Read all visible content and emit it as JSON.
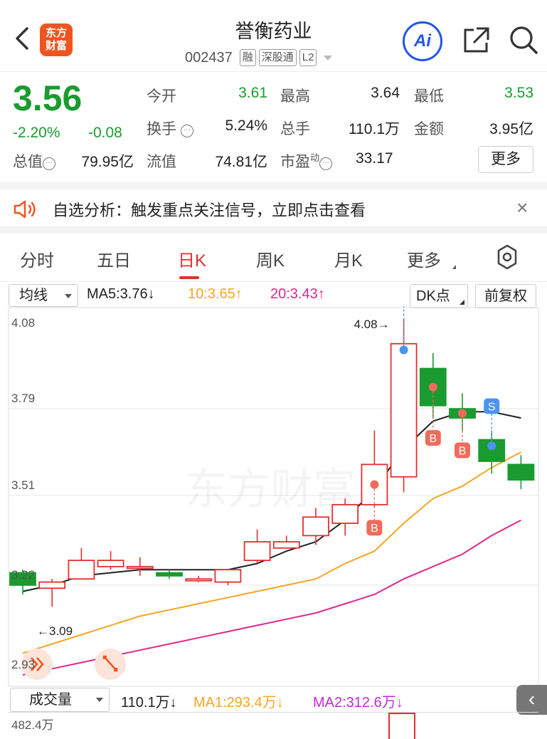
{
  "header": {
    "title": "誉衡药业",
    "code": "002437",
    "tags": [
      "融",
      "深股通",
      "L2"
    ],
    "logo_text": [
      "东方",
      "财富"
    ],
    "ai_label": "Ai",
    "icons": [
      "back-chevron-icon",
      "share-icon",
      "search-icon"
    ]
  },
  "quote": {
    "price": "3.56",
    "change_pct": "-2.20%",
    "change": "-0.08",
    "open_label": "今开",
    "open": "3.61",
    "high_label": "最高",
    "high": "3.64",
    "low_label": "最低",
    "low": "3.53",
    "turnover_label": "换手",
    "turnover": "5.24%",
    "volume_label": "总手",
    "volume": "110.1万",
    "amount_label": "金额",
    "amount": "3.95亿",
    "mktcap_label": "总值",
    "mktcap": "79.95亿",
    "float_label": "流值",
    "float_cap": "74.81亿",
    "pe_label": "市盈",
    "pe_sup": "动",
    "pe": "33.17",
    "more_label": "更多",
    "colors": {
      "down": "#1a9b2f",
      "up": "#e03030"
    }
  },
  "notice": {
    "text": "自选分析：触发重点关注信号，立即点击查看",
    "icon": "speaker-icon",
    "close": "×"
  },
  "tabs": {
    "items": [
      "分时",
      "五日",
      "日K",
      "周K",
      "月K",
      "更多"
    ],
    "active": "日K",
    "settings_icon": "gear-icon"
  },
  "indicators": {
    "main_select": "均线",
    "ma5": "MA5:3.76↓",
    "ma10": "10:3.65↑",
    "ma20": "20:3.43↑",
    "dk": "DK点",
    "adjust": "前复权",
    "colors": {
      "ma5": "#222222",
      "ma10": "#f5a623",
      "ma20": "#e0288a"
    }
  },
  "chart_data": {
    "type": "candlestick",
    "y_ticks": [
      "4.08",
      "3.79",
      "3.51",
      "3.22",
      "2.93"
    ],
    "ylim": [
      2.93,
      4.08
    ],
    "max_label": "4.08→",
    "min_label": "←3.09",
    "watermark": "东方财富",
    "candles": [
      {
        "o": 3.26,
        "c": 3.22,
        "h": 3.27,
        "l": 3.19
      },
      {
        "o": 3.21,
        "c": 3.23,
        "h": 3.24,
        "l": 3.15
      },
      {
        "o": 3.24,
        "c": 3.3,
        "h": 3.34,
        "l": 3.24
      },
      {
        "o": 3.28,
        "c": 3.3,
        "h": 3.33,
        "l": 3.27
      },
      {
        "o": 3.28,
        "c": 3.28,
        "h": 3.31,
        "l": 3.25
      },
      {
        "o": 3.26,
        "c": 3.25,
        "h": 3.27,
        "l": 3.24
      },
      {
        "o": 3.24,
        "c": 3.24,
        "h": 3.25,
        "l": 3.23
      },
      {
        "o": 3.23,
        "c": 3.27,
        "h": 3.27,
        "l": 3.22
      },
      {
        "o": 3.3,
        "c": 3.36,
        "h": 3.4,
        "l": 3.29
      },
      {
        "o": 3.34,
        "c": 3.36,
        "h": 3.38,
        "l": 3.34
      },
      {
        "o": 3.38,
        "c": 3.44,
        "h": 3.47,
        "l": 3.35
      },
      {
        "o": 3.42,
        "c": 3.48,
        "h": 3.5,
        "l": 3.38
      },
      {
        "o": 3.48,
        "c": 3.61,
        "h": 3.72,
        "l": 3.47
      },
      {
        "o": 3.57,
        "c": 4.0,
        "h": 4.08,
        "l": 3.52
      },
      {
        "o": 3.92,
        "c": 3.8,
        "h": 3.97,
        "l": 3.76
      },
      {
        "o": 3.79,
        "c": 3.76,
        "h": 3.84,
        "l": 3.72
      },
      {
        "o": 3.69,
        "c": 3.62,
        "h": 3.72,
        "l": 3.58
      },
      {
        "o": 3.61,
        "c": 3.56,
        "h": 3.64,
        "l": 3.53
      }
    ],
    "ma5": [
      3.2,
      3.22,
      3.25,
      3.26,
      3.27,
      3.27,
      3.27,
      3.27,
      3.29,
      3.33,
      3.36,
      3.43,
      3.53,
      3.66,
      3.75,
      3.78,
      3.78,
      3.76
    ],
    "ma10": [
      3.0,
      3.03,
      3.06,
      3.09,
      3.12,
      3.14,
      3.16,
      3.18,
      3.2,
      3.22,
      3.24,
      3.29,
      3.33,
      3.42,
      3.5,
      3.54,
      3.6,
      3.65
    ],
    "ma20": [
      2.93,
      2.95,
      2.97,
      2.99,
      3.01,
      3.03,
      3.05,
      3.07,
      3.09,
      3.11,
      3.13,
      3.16,
      3.19,
      3.24,
      3.28,
      3.32,
      3.38,
      3.43
    ],
    "signals": [
      {
        "type": "S",
        "i": 13
      },
      {
        "type": "B",
        "i": 12
      },
      {
        "type": "B",
        "i": 14
      },
      {
        "type": "B",
        "i": 15
      },
      {
        "type": "S",
        "i": 16
      }
    ]
  },
  "volume": {
    "select": "成交量",
    "value": "110.1万↓",
    "ma1": "MA1:293.4万↓",
    "ma2": "MA2:312.6万↓",
    "y_top": "482.4万",
    "collapse_icon": "chevron-left-icon",
    "colors": {
      "ma1": "#f5a623",
      "ma2": "#c02bd8"
    }
  }
}
